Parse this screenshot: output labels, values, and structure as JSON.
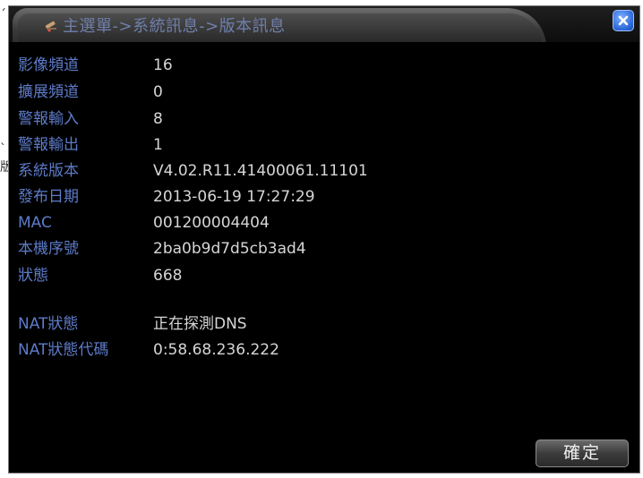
{
  "window": {
    "title": "主選單->系統訊息->版本訊息",
    "title_icon": "edit-pencil-icon",
    "close_icon": "close-x-icon"
  },
  "info_rows": [
    {
      "label": "影像頻道",
      "value": "16"
    },
    {
      "label": "擴展頻道",
      "value": "0"
    },
    {
      "label": "警報輸入",
      "value": "8"
    },
    {
      "label": "警報輸出",
      "value": "1"
    },
    {
      "label": "系統版本",
      "value": "V4.02.R11.41400061.11101"
    },
    {
      "label": "發布日期",
      "value": "2013-06-19 17:27:29"
    },
    {
      "label": "MAC",
      "value": "001200004404"
    },
    {
      "label": "本機序號",
      "value": "2ba0b9d7d5cb3ad4"
    },
    {
      "label": "狀態",
      "value": "668"
    }
  ],
  "nat_rows": [
    {
      "label": "NAT狀態",
      "value": "正在探測DNS"
    },
    {
      "label": "NAT狀態代碼",
      "value": "0:58.68.236.222"
    }
  ],
  "buttons": {
    "ok_label": "確定"
  },
  "background_fragments": [
    "ˊ",
    "ˋ",
    "版"
  ],
  "colors": {
    "label": "#5d7bc8",
    "value": "#d6d6d6",
    "title": "#6f7faa",
    "close_button": "#2a66d8",
    "dialog_background": "#000000"
  }
}
